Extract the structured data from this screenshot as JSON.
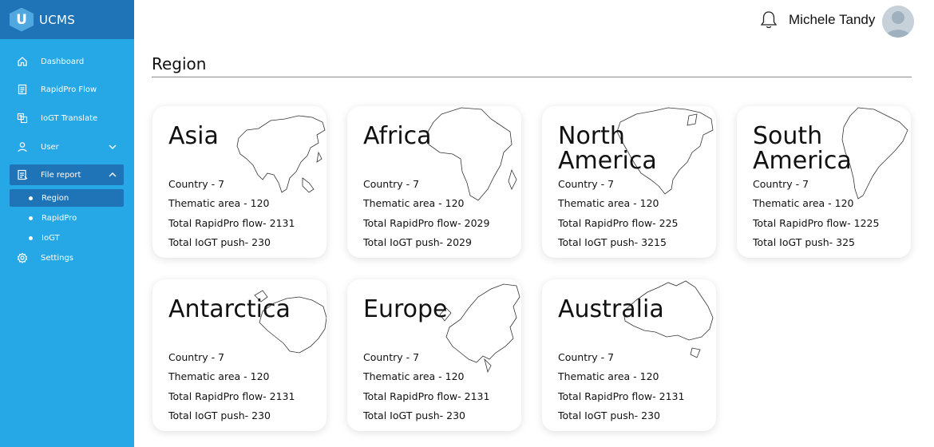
{
  "brand": {
    "logo_letter": "U",
    "name": "UCMS"
  },
  "sidebar": {
    "items": [
      {
        "label": "Dashboard",
        "icon": "home-icon"
      },
      {
        "label": "RapidPro Flow",
        "icon": "document-icon"
      },
      {
        "label": "IoGT Translate",
        "icon": "translate-icon"
      },
      {
        "label": "User",
        "icon": "user-icon"
      },
      {
        "label": "File report",
        "icon": "file-report-icon"
      },
      {
        "label": "Settings",
        "icon": "gear-icon"
      }
    ],
    "sub_items": [
      {
        "label": "Region"
      },
      {
        "label": "RapidPro"
      },
      {
        "label": "IoGT"
      }
    ]
  },
  "header": {
    "user_name": "Michele Tandy"
  },
  "page": {
    "title": "Region"
  },
  "regions": [
    {
      "name": "Asia",
      "country": "Country - 7",
      "thematic": "Thematic area - 120",
      "rapidpro": "Total RapidPro flow- 2131",
      "iogt": "Total IoGT push- 230"
    },
    {
      "name": "Africa",
      "country": "Country - 7",
      "thematic": "Thematic area - 120",
      "rapidpro": "Total RapidPro flow- 2029",
      "iogt": "Total IoGT push- 2029"
    },
    {
      "name": "North America",
      "country": "Country - 7",
      "thematic": "Thematic area - 120",
      "rapidpro": "Total RapidPro flow- 225",
      "iogt": "Total IoGT push- 3215"
    },
    {
      "name": "South America",
      "country": "Country - 7",
      "thematic": "Thematic area - 120",
      "rapidpro": "Total RapidPro flow- 1225",
      "iogt": "Total IoGT push- 325"
    },
    {
      "name": "Antarctica",
      "country": "Country - 7",
      "thematic": "Thematic area - 120",
      "rapidpro": "Total RapidPro flow- 2131",
      "iogt": "Total IoGT push- 230"
    },
    {
      "name": "Europe",
      "country": "Country - 7",
      "thematic": "Thematic area - 120",
      "rapidpro": "Total RapidPro flow- 2131",
      "iogt": "Total IoGT push- 230"
    },
    {
      "name": "Australia",
      "country": "Country - 7",
      "thematic": "Thematic area - 120",
      "rapidpro": "Total RapidPro flow- 2131",
      "iogt": "Total IoGT push- 230"
    }
  ],
  "colors": {
    "sidebar_bg": "#26a7e6",
    "sidebar_active": "#1f74b8",
    "brand_bg": "#1f74b8"
  }
}
